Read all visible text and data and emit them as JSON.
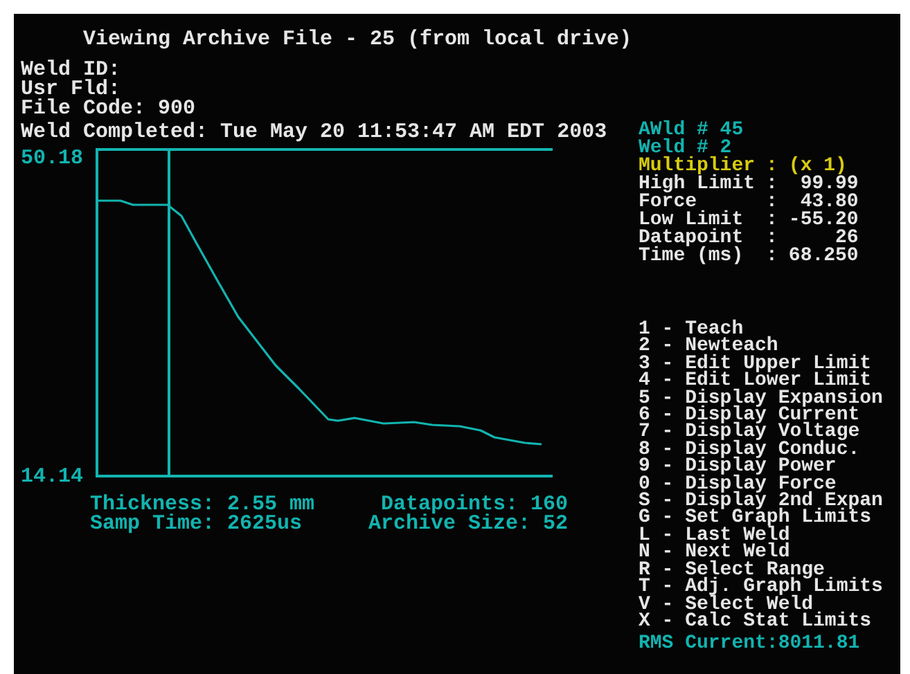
{
  "title": "Viewing Archive File - 25 (from local drive)",
  "info_lines": [
    "Weld ID:",
    "Usr Fld:",
    "File Code: 900",
    "Weld Completed: Tue May 20 11:53:47 AM EDT 2003"
  ],
  "graph": {
    "y_max_label": "50.18",
    "y_min_label": "14.14"
  },
  "graph_stats": [
    {
      "label": "Thickness: 2.55 mm",
      "value": "Datapoints: 160"
    },
    {
      "label": "Samp Time: 2625us",
      "value": "Archive Size: 52"
    }
  ],
  "weld_panel": [
    {
      "kind": "heading",
      "label": "AWld # 45"
    },
    {
      "kind": "heading",
      "label": "Weld # 2"
    },
    {
      "kind": "multiplier",
      "label": "Multiplier",
      "sep": ":",
      "value": "(x 1)"
    },
    {
      "kind": "reading",
      "label": "High Limit",
      "sep": ":",
      "value": "99.99"
    },
    {
      "kind": "reading",
      "label": "Force",
      "sep": ":",
      "value": "43.80"
    },
    {
      "kind": "reading",
      "label": "Low Limit",
      "sep": ":",
      "value": "-55.20"
    },
    {
      "kind": "reading",
      "label": "Datapoint",
      "sep": ":",
      "value": "26"
    },
    {
      "kind": "reading",
      "label": "Time (ms)",
      "sep": ":",
      "value": "68.250"
    }
  ],
  "menu": [
    "1 - Teach",
    "2 - Newteach",
    "3 - Edit Upper Limit",
    "4 - Edit Lower Limit",
    "5 - Display Expansion",
    "6 - Display Current",
    "7 - Display Voltage",
    "8 - Display Conduc.",
    "9 - Display Power",
    "0 - Display Force",
    "S - Display 2nd Expan",
    "G - Set Graph Limits",
    "L - Last Weld",
    "N - Next Weld",
    "R - Select Range",
    "T - Adj. Graph Limits",
    "V - Select Weld",
    "X - Calc Stat Limits"
  ],
  "status": "RMS Current:8011.81"
}
